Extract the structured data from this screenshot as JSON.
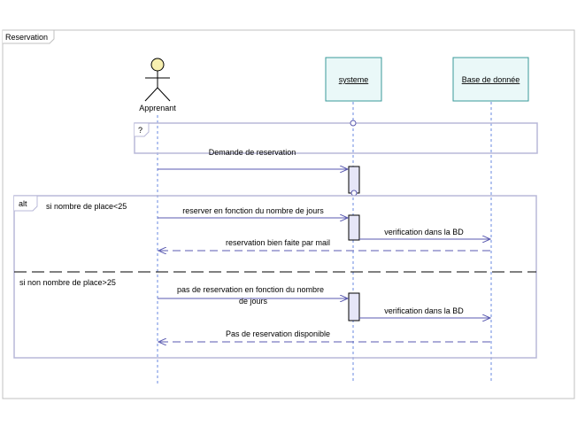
{
  "frame": {
    "title": "Reservation"
  },
  "lifelines": {
    "actor": "Apprenant",
    "system": "systeme",
    "db": "Base de donnée"
  },
  "fragments": {
    "opt_guard": "?",
    "alt_label": "alt",
    "alt_guard1": "si nombre de place<25",
    "alt_guard2": "si non  nombre de place>25"
  },
  "messages": {
    "m1": "Demande de reservation",
    "m2": "reserver en fonction du nombre de jours",
    "m3": "verification dans la BD",
    "m4": "reservation bien faite par mail",
    "m5_line1": "pas de reservation en fonction du nombre",
    "m5_line2": "de jours",
    "m6": "verification dans la BD",
    "m7": "Pas de reservation disponible"
  },
  "colors": {
    "frame": "#c0c0c0",
    "fragment": "#b8b8d8",
    "message": "#5a5ab0",
    "lifeline_box_border": "#3a9a9a",
    "lifeline_box_fill": "#eaf8f8",
    "activation_fill": "#e6e6f8",
    "actor_head": "#f8f0b0"
  }
}
